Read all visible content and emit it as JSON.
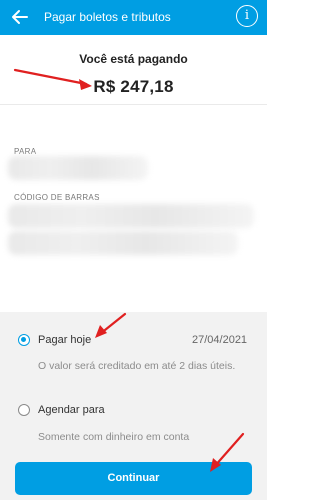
{
  "app_bar": {
    "title": "Pagar boletos e tributos",
    "back_icon": "arrow-left-icon",
    "info_icon": "info-icon",
    "info_glyph": "i"
  },
  "summary": {
    "label": "Você está pagando",
    "amount": "R$ 247,18"
  },
  "details": {
    "para_label": "PARA",
    "barcode_label": "CÓDIGO DE BARRAS"
  },
  "options": {
    "pay_today": {
      "label": "Pagar hoje",
      "date": "27/04/2021",
      "description": "O valor será creditado em até 2 dias úteis.",
      "selected": true
    },
    "schedule": {
      "label": "Agendar para",
      "description": "Somente com dinheiro em conta",
      "selected": false
    }
  },
  "continue_button": {
    "label": "Continuar"
  },
  "colors": {
    "primary": "#009ee3",
    "annotation_arrow": "#e02020"
  }
}
